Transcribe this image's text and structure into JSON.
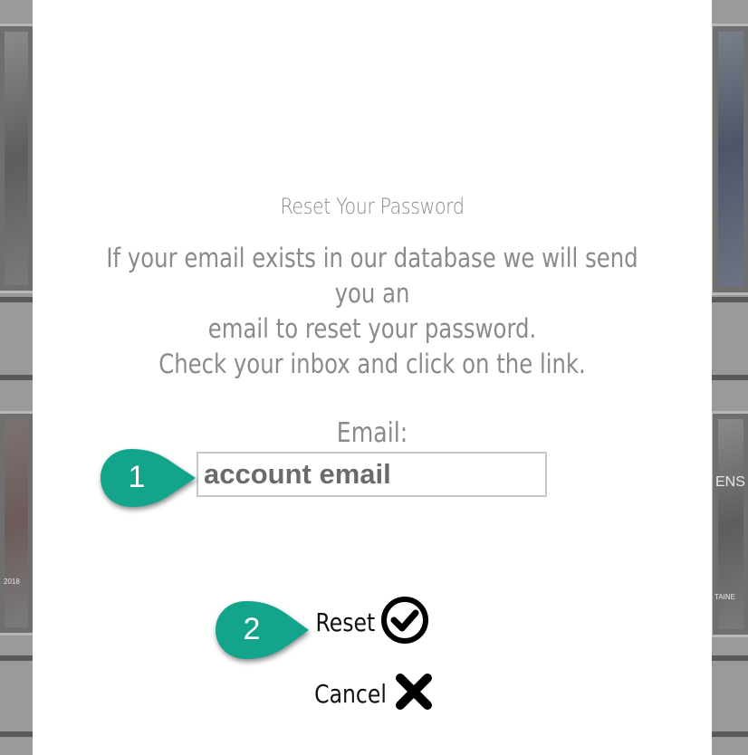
{
  "modal": {
    "title": "Reset Your Password",
    "description_lines": [
      "If your email exists in our database we will send you an",
      "email to reset your password.",
      "Check your inbox and click on the link."
    ],
    "email_label": "Email:",
    "email_value": "account email",
    "reset_label": "Reset",
    "cancel_label": "Cancel",
    "reset_icon": "check-circle-icon",
    "cancel_icon": "close-x-icon"
  },
  "callouts": [
    {
      "number": "1",
      "target": "email-input"
    },
    {
      "number": "2",
      "target": "reset-button"
    }
  ],
  "background": {
    "tags": [
      "2018",
      "ENS",
      "TAINE"
    ]
  },
  "colors": {
    "callout": "#13a58c",
    "muted_text": "#8a8a8a",
    "overlay": "#9a9a9a"
  }
}
